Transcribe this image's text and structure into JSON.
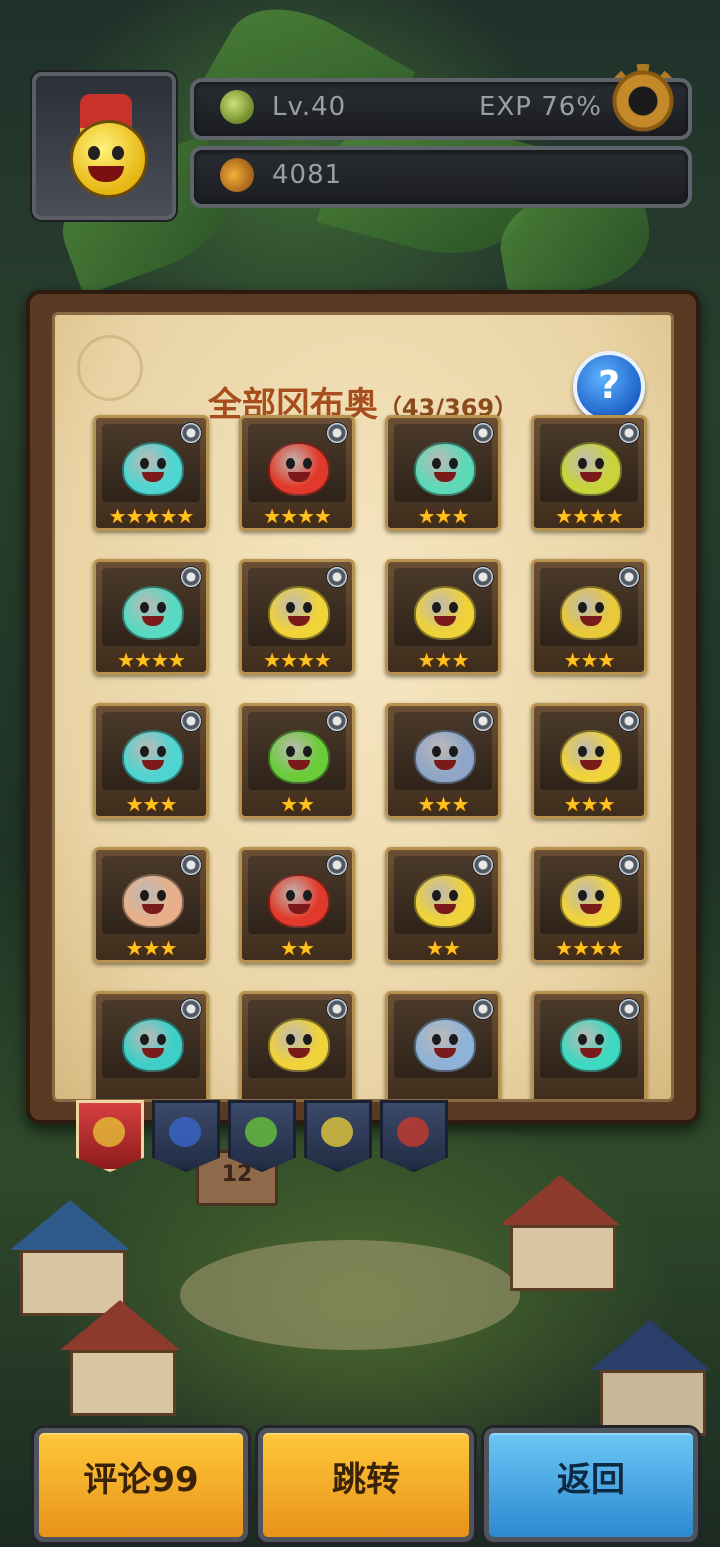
{
  "header": {
    "level": "Lv.40",
    "exp": "EXP 76%",
    "coins": "4081"
  },
  "collection": {
    "title": "全部冈布奥",
    "count": "（43/369）",
    "help_label": "?"
  },
  "cards": [
    {
      "stars": "★★★★★",
      "color": "#4fd6d0"
    },
    {
      "stars": "★★★★",
      "color": "#e23a2a"
    },
    {
      "stars": "★★★",
      "color": "#5ed9b8"
    },
    {
      "stars": "★★★★",
      "color": "#c9d43a"
    },
    {
      "stars": "★★★★",
      "color": "#58d9c2"
    },
    {
      "stars": "★★★★",
      "color": "#f1d33a"
    },
    {
      "stars": "★★★",
      "color": "#efd23a"
    },
    {
      "stars": "★★★",
      "color": "#e9c83a"
    },
    {
      "stars": "★★★",
      "color": "#4fd4d0"
    },
    {
      "stars": "★★",
      "color": "#6bcc3a"
    },
    {
      "stars": "★★★",
      "color": "#8fa6c8"
    },
    {
      "stars": "★★★",
      "color": "#f0d23a"
    },
    {
      "stars": "★★★",
      "color": "#e8b08a"
    },
    {
      "stars": "★★",
      "color": "#e23a2a"
    },
    {
      "stars": "★★",
      "color": "#f0d23a"
    },
    {
      "stars": "★★★★",
      "color": "#f0d23a"
    },
    {
      "stars": "",
      "color": "#3fcfc6"
    },
    {
      "stars": "",
      "color": "#f0d23a"
    },
    {
      "stars": "",
      "color": "#8fb3d8"
    },
    {
      "stars": "",
      "color": "#3fd8c0"
    }
  ],
  "tabs": [
    {
      "name": "all",
      "color": "#e9c83a"
    },
    {
      "name": "blue",
      "color": "#3a6ad0"
    },
    {
      "name": "green",
      "color": "#6bcc3a"
    },
    {
      "name": "yellow",
      "color": "#f0d23a"
    },
    {
      "name": "red",
      "color": "#d23a2a"
    }
  ],
  "scene": {
    "sign_number": "12"
  },
  "buttons": {
    "comment": "评论99",
    "jump": "跳转",
    "back": "返回"
  }
}
